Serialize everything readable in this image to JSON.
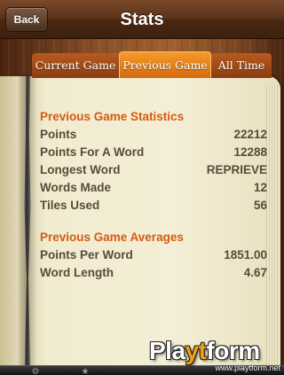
{
  "navbar": {
    "back_label": "Back",
    "title": "Stats"
  },
  "tabs": [
    {
      "label": "Current Game",
      "selected": false
    },
    {
      "label": "Previous Game",
      "selected": true
    },
    {
      "label": "All Time",
      "selected": false
    }
  ],
  "statistics": {
    "title": "Previous Game Statistics",
    "rows": [
      {
        "label": "Points",
        "value": "22212"
      },
      {
        "label": "Points For A Word",
        "value": "12288"
      },
      {
        "label": "Longest Word",
        "value": "REPRIEVE"
      },
      {
        "label": "Words Made",
        "value": "12"
      },
      {
        "label": "Tiles Used",
        "value": "56"
      }
    ]
  },
  "averages": {
    "title": "Previous Game Averages",
    "rows": [
      {
        "label": "Points Per Word",
        "value": "1851.00"
      },
      {
        "label": "Word Length",
        "value": "4.67"
      }
    ]
  },
  "tabbar": {
    "icons": [
      "gear-icon",
      "star-icon"
    ]
  },
  "watermark": {
    "logo_prefix": "Pla",
    "logo_highlight": "yt",
    "logo_suffix": "form",
    "url": "www.playtform.net"
  },
  "colors": {
    "accent": "#d45b10",
    "text": "#5a4a3a",
    "selected_tab": "#f59a2a"
  }
}
